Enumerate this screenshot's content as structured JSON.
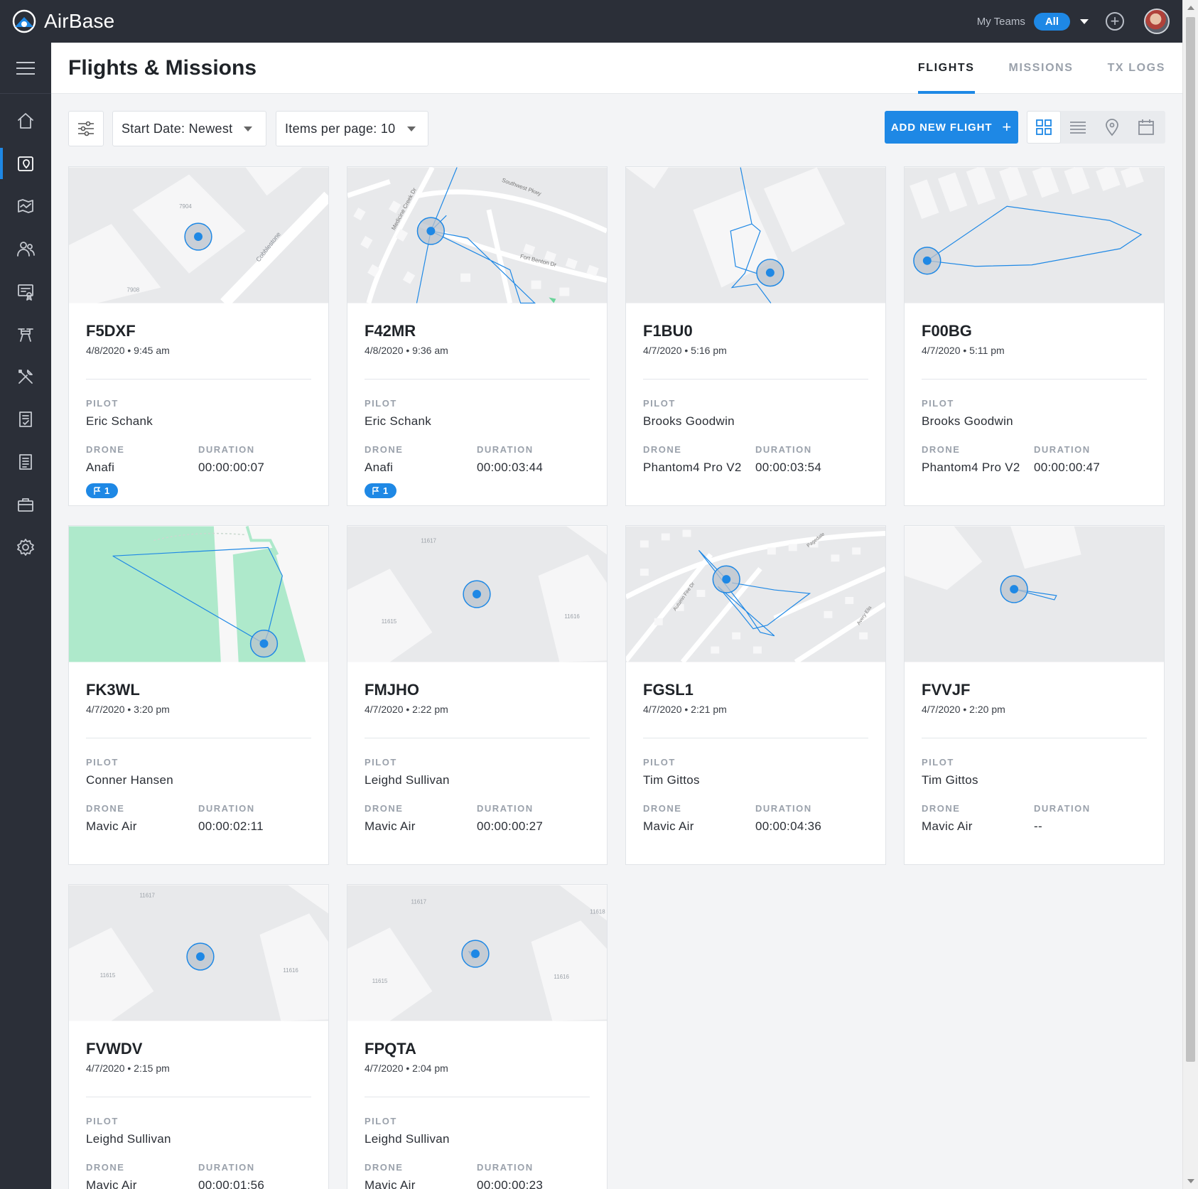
{
  "app": {
    "name": "AirBase"
  },
  "topbar": {
    "teams_label": "My Teams",
    "teams_value": "All"
  },
  "sidebar": {
    "items": [
      {
        "name": "home-icon"
      },
      {
        "name": "flights-icon",
        "active": true
      },
      {
        "name": "map-icon"
      },
      {
        "name": "people-icon"
      },
      {
        "name": "certificate-icon"
      },
      {
        "name": "drone-icon"
      },
      {
        "name": "tools-icon"
      },
      {
        "name": "checklist-icon"
      },
      {
        "name": "document-icon"
      },
      {
        "name": "briefcase-icon"
      },
      {
        "name": "settings-icon"
      }
    ]
  },
  "header": {
    "title": "Flights & Missions",
    "tabs": [
      {
        "label": "FLIGHTS",
        "active": true
      },
      {
        "label": "MISSIONS"
      },
      {
        "label": "TX LOGS"
      }
    ]
  },
  "toolbar": {
    "sort_label": "Start Date: Newest",
    "per_page_label": "Items per page: 10",
    "add_button": "ADD NEW FLIGHT",
    "views": [
      "grid-icon",
      "list-icon",
      "map-pin-icon",
      "calendar-icon"
    ]
  },
  "labels": {
    "pilot": "PILOT",
    "drone": "DRONE",
    "duration": "DURATION"
  },
  "colors": {
    "accent": "#1e88e5",
    "sidebar": "#2b2f38",
    "map_bg": "#e8e9eb",
    "park": "#aee9cb"
  },
  "flights": [
    {
      "id": "F5DXF",
      "date": "4/8/2020 • 9:45 am",
      "pilot": "Eric Schank",
      "drone": "Anafi",
      "duration": "00:00:00:07",
      "flags": "1",
      "map": {
        "street": "Cobblestone",
        "addr1": "7904",
        "addr2": "7908"
      }
    },
    {
      "id": "F42MR",
      "date": "4/8/2020 • 9:36 am",
      "pilot": "Eric Schank",
      "drone": "Anafi",
      "duration": "00:00:03:44",
      "flags": "1",
      "map": {
        "street1": "Southwest Pkwy",
        "street2": "Fort Benton Dr",
        "street3": "Medicine Creek Dr"
      }
    },
    {
      "id": "F1BU0",
      "date": "4/7/2020 • 5:16 pm",
      "pilot": "Brooks Goodwin",
      "drone": "Phantom4 Pro V2",
      "duration": "00:00:03:54"
    },
    {
      "id": "F00BG",
      "date": "4/7/2020 • 5:11 pm",
      "pilot": "Brooks Goodwin",
      "drone": "Phantom4 Pro V2",
      "duration": "00:00:00:47"
    },
    {
      "id": "FK3WL",
      "date": "4/7/2020 • 3:20 pm",
      "pilot": "Conner Hansen",
      "drone": "Mavic Air",
      "duration": "00:00:02:11"
    },
    {
      "id": "FMJHO",
      "date": "4/7/2020 • 2:22 pm",
      "pilot": "Leighd Sullivan",
      "drone": "Mavic Air",
      "duration": "00:00:00:27",
      "map": {
        "addr1": "11617",
        "addr2": "11615",
        "addr3": "11616"
      }
    },
    {
      "id": "FGSL1",
      "date": "4/7/2020 • 2:21 pm",
      "pilot": "Tim Gittos",
      "drone": "Mavic Air",
      "duration": "00:00:04:36",
      "map": {
        "street1": "Pagedale",
        "street2": "Autumn Fire Dr",
        "street3": "Avery Elis"
      }
    },
    {
      "id": "FVVJF",
      "date": "4/7/2020 • 2:20 pm",
      "pilot": "Tim Gittos",
      "drone": "Mavic Air",
      "duration": "--"
    },
    {
      "id": "FVWDV",
      "date": "4/7/2020 • 2:15 pm",
      "pilot": "Leighd Sullivan",
      "drone": "Mavic Air",
      "duration": "00:00:01:56",
      "map": {
        "addr1": "11617",
        "addr2": "11615",
        "addr3": "11616"
      }
    },
    {
      "id": "FPQTA",
      "date": "4/7/2020 • 2:04 pm",
      "pilot": "Leighd Sullivan",
      "drone": "Mavic Air",
      "duration": "00:00:00:23",
      "map": {
        "addr1": "11617",
        "addr2": "11615",
        "addr3": "11616",
        "addr4": "11618"
      }
    }
  ]
}
